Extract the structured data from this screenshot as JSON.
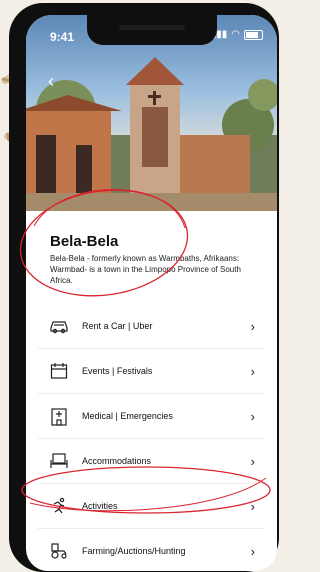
{
  "status": {
    "time": "9:41"
  },
  "location": {
    "title": "Bela-Bela",
    "description": "Bela-Bela - formerly known as Warmbaths, Afrikaans: Warmbad- is a town in the Limpopo Province of South Africa."
  },
  "menu": [
    {
      "label": "Rent a Car | Uber",
      "icon": "car-icon"
    },
    {
      "label": "Events | Festivals",
      "icon": "calendar-icon"
    },
    {
      "label": "Medical | Emergencies",
      "icon": "hospital-icon"
    },
    {
      "label": "Accommodations",
      "icon": "bed-icon"
    },
    {
      "label": "Activities",
      "icon": "running-person-icon"
    },
    {
      "label": "Farming/Auctions/Hunting",
      "icon": "tractor-icon"
    }
  ],
  "colors": {
    "annotation": "#d9252f",
    "frame": "#0f0f0f",
    "background": "#f3efe6"
  }
}
